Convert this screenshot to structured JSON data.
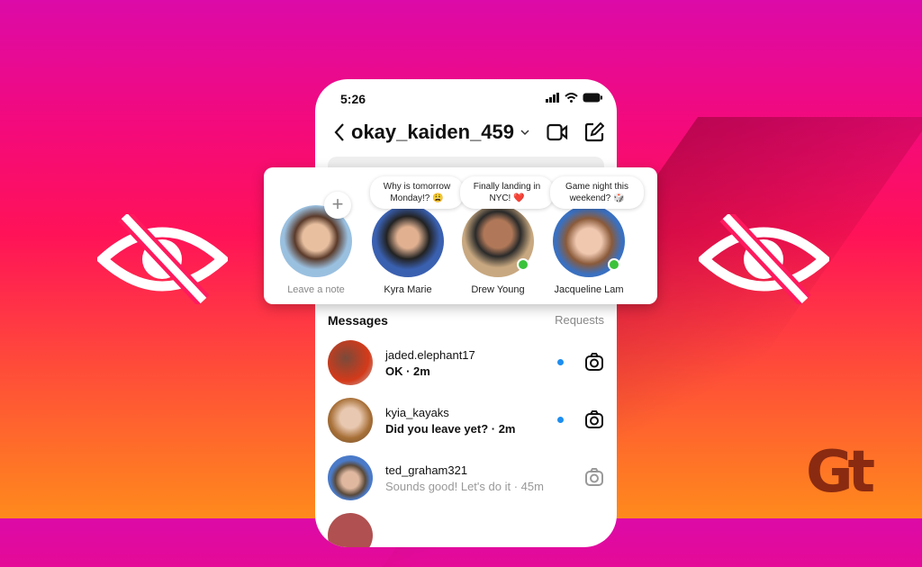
{
  "status_bar": {
    "time": "5:26"
  },
  "header": {
    "username": "okay_kaiden_459"
  },
  "notes": [
    {
      "name": "Leave a note",
      "note": "",
      "self": true,
      "online": false
    },
    {
      "name": "Kyra Marie",
      "note": "Why is tomorrow Monday!? 😩",
      "online": false
    },
    {
      "name": "Drew Young",
      "note": "Finally landing in NYC! ❤️",
      "online": true
    },
    {
      "name": "Jacqueline Lam",
      "note": "Game night this weekend? 🎲",
      "online": true
    }
  ],
  "messages": {
    "title": "Messages",
    "requests": "Requests",
    "items": [
      {
        "user": "jaded.elephant17",
        "preview": "OK · 2m",
        "unread": true
      },
      {
        "user": "kyia_kayaks",
        "preview": "Did you leave yet? · 2m",
        "unread": true
      },
      {
        "user": "ted_graham321",
        "preview": "Sounds good! Let's do it · 45m",
        "unread": false
      }
    ]
  },
  "logo": "Gt",
  "colors": {
    "unread_dot": "#1d8ef0",
    "online": "#3bc23b"
  }
}
